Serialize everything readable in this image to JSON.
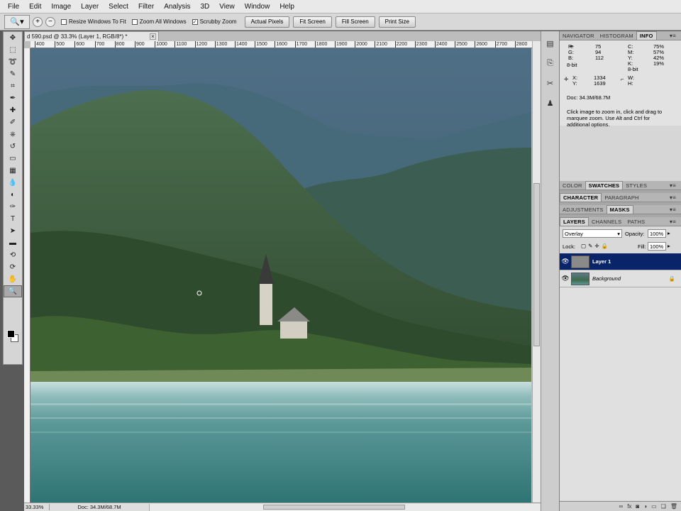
{
  "menu": [
    "File",
    "Edit",
    "Image",
    "Layer",
    "Select",
    "Filter",
    "Analysis",
    "3D",
    "View",
    "Window",
    "Help"
  ],
  "options": {
    "tool_icon": "zoom-icon",
    "checks": [
      {
        "label": "Resize Windows To Fit",
        "checked": false
      },
      {
        "label": "Zoom All Windows",
        "checked": false
      },
      {
        "label": "Scrubby Zoom",
        "checked": true
      }
    ],
    "buttons": [
      "Actual Pixels",
      "Fit Screen",
      "Fill Screen",
      "Print Size"
    ]
  },
  "document": {
    "tab_title": "d 590.psd @ 33.3% (Layer 1, RGB/8*) *",
    "ruler_ticks": [
      "400",
      "500",
      "600",
      "700",
      "800",
      "900",
      "1000",
      "1100",
      "1200",
      "1300",
      "1400",
      "1500",
      "1600",
      "1700",
      "1800",
      "1900",
      "2000",
      "2100",
      "2200",
      "2300",
      "2400",
      "2500",
      "2600",
      "2700",
      "2800"
    ],
    "zoom": "33.33%",
    "status": "Doc: 34.3M/68.7M"
  },
  "tools": [
    "move-icon",
    "marquee-icon",
    "lasso-icon",
    "quick-select-icon",
    "crop-icon",
    "eyedropper-icon",
    "healing-brush-icon",
    "brush-icon",
    "clone-stamp-icon",
    "history-brush-icon",
    "eraser-icon",
    "gradient-icon",
    "blur-icon",
    "dodge-icon",
    "pen-icon",
    "type-icon",
    "path-select-icon",
    "shape-icon",
    "3d-rotate-icon",
    "3d-orbit-icon",
    "hand-icon",
    "zoom-icon"
  ],
  "info_panel": {
    "tabs": [
      "NAVIGATOR",
      "HISTOGRAM",
      "INFO"
    ],
    "r": "75",
    "g": "94",
    "b": "112",
    "c": "75%",
    "m": "57%",
    "y": "42%",
    "k": "19%",
    "bit_left": "8-bit",
    "bit_right": "8-bit",
    "x": "1334",
    "y_coord": "1639",
    "w": "",
    "h": "",
    "doc": "Doc: 34.3M/68.7M",
    "hint": "Click image to zoom in, click and drag to marquee zoom.  Use Alt and Ctrl for additional options."
  },
  "color_tabs": [
    "COLOR",
    "SWATCHES",
    "STYLES"
  ],
  "char_tabs": [
    "CHARACTER",
    "PARAGRAPH"
  ],
  "adj_tabs": [
    "ADJUSTMENTS",
    "MASKS"
  ],
  "layers_panel": {
    "tabs": [
      "LAYERS",
      "CHANNELS",
      "PATHS"
    ],
    "blend_mode": "Overlay",
    "opacity_label": "Opacity:",
    "opacity": "100%",
    "lock_label": "Lock:",
    "fill_label": "Fill:",
    "fill": "100%",
    "layers": [
      {
        "name": "Layer 1",
        "selected": true,
        "locked": false
      },
      {
        "name": "Background",
        "selected": false,
        "locked": true
      }
    ]
  }
}
